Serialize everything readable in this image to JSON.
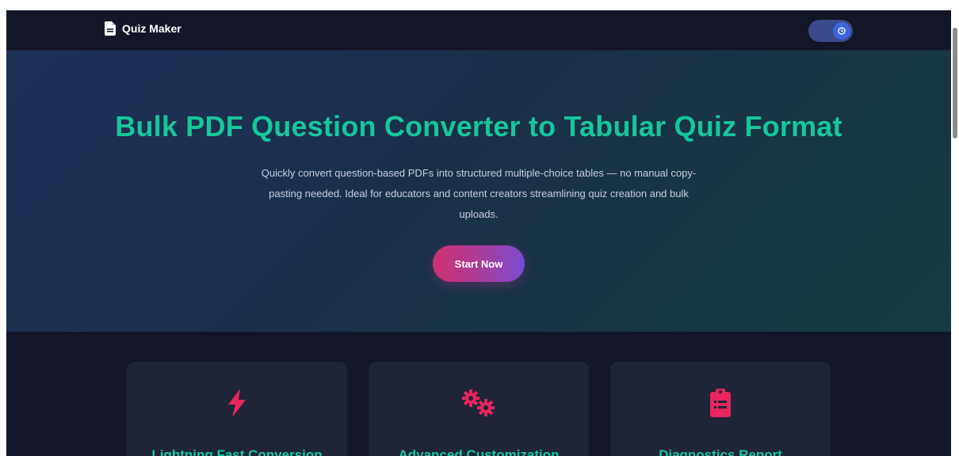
{
  "navbar": {
    "brand_name": "Quiz Maker",
    "brand_icon": "document-icon",
    "theme_toggle_icon": "moon-icon"
  },
  "hero": {
    "title": "Bulk PDF Question Converter to Tabular Quiz Format",
    "subtitle": "Quickly convert question-based PDFs into structured multiple-choice tables — no manual copy-pasting needed. Ideal for educators and content creators streamlining quiz creation and bulk uploads.",
    "cta_label": "Start Now"
  },
  "features": [
    {
      "icon": "lightning-icon",
      "title": "Lightning Fast Conversion"
    },
    {
      "icon": "gears-icon",
      "title": "Advanced Customization"
    },
    {
      "icon": "clipboard-icon",
      "title": "Diagnostics Report"
    }
  ],
  "colors": {
    "accent_green": "#16c79a",
    "accent_pink": "#e8255f",
    "page_background": "#14172a",
    "card_background": "#1f2536"
  }
}
